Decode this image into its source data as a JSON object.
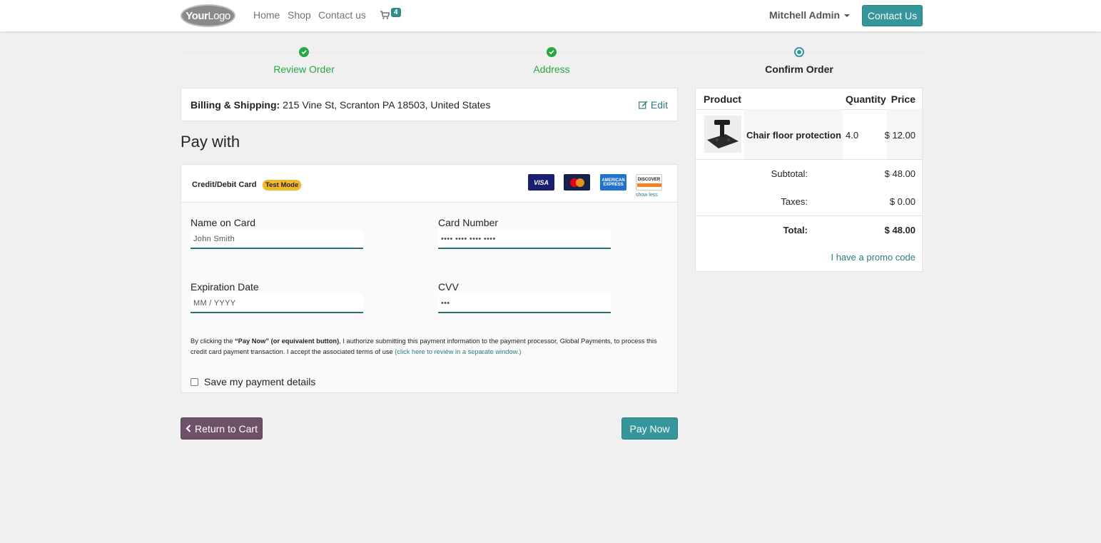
{
  "nav": {
    "logo_text_1": "Your",
    "logo_text_2": "Logo",
    "links": [
      "Home",
      "Shop",
      "Contact us"
    ],
    "cart_count": "4",
    "user": "Mitchell Admin",
    "contact_button": "Contact Us"
  },
  "steps": [
    {
      "label": "Review Order",
      "state": "done"
    },
    {
      "label": "Address",
      "state": "done"
    },
    {
      "label": "Confirm Order",
      "state": "current"
    }
  ],
  "billing": {
    "label": "Billing & Shipping:",
    "address": "215 Vine St, Scranton PA 18503, United States",
    "edit": "Edit"
  },
  "pay_with": "Pay with",
  "payment": {
    "method": "Credit/Debit Card",
    "badge": "Test Mode",
    "cards": [
      "VISA",
      "MasterCard",
      "AMERICAN EXPRESS",
      "DISCOVER"
    ],
    "show_less": "show less",
    "fields": {
      "name_label": "Name on Card",
      "name_value": "John Smith",
      "number_label": "Card Number",
      "number_value": "•••• •••• •••• ••••",
      "exp_label": "Expiration Date",
      "exp_placeholder": "MM / YYYY",
      "cvv_label": "CVV",
      "cvv_value": "•••"
    },
    "disclaimer_1": "By clicking the ",
    "disclaimer_bold": "“Pay Now” (or equivalent button)",
    "disclaimer_2": ", I authorize submitting this payment information to the payment processor, Global Payments, to process this credit card payment transaction. I accept the associated terms of use ",
    "disclaimer_link": "(click here to review in a separate window.)",
    "save_label": "Save my payment details"
  },
  "buttons": {
    "return": "Return to Cart",
    "pay": "Pay Now"
  },
  "summary": {
    "headers": {
      "product": "Product",
      "quantity": "Quantity",
      "price": "Price"
    },
    "item": {
      "name": "Chair floor protection",
      "quantity": "4.0",
      "price": "$ 12.00"
    },
    "subtotal_label": "Subtotal:",
    "subtotal": "$ 48.00",
    "taxes_label": "Taxes:",
    "taxes": "$ 0.00",
    "total_label": "Total:",
    "total": "$ 48.00",
    "promo": "I have a promo code"
  },
  "colors": {
    "accent": "#35979c",
    "secondary": "#6e5169",
    "success": "#28a745",
    "badge": "#f0b92c"
  }
}
